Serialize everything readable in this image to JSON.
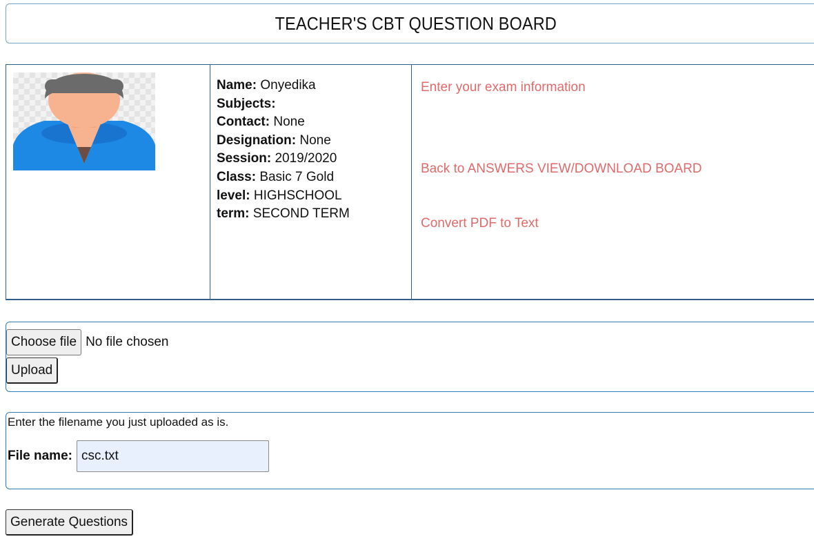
{
  "header": {
    "title": "TEACHER'S CBT QUESTION BOARD"
  },
  "profile": {
    "avatar_icon": "user-avatar-icon",
    "fields": [
      {
        "label": "Name:",
        "value": "Onyedika"
      },
      {
        "label": "Subjects:",
        "value": ""
      },
      {
        "label": "Contact:",
        "value": "None"
      },
      {
        "label": "Designation:",
        "value": "None"
      },
      {
        "label": "Session:",
        "value": "2019/2020"
      },
      {
        "label": "Class:",
        "value": "Basic 7 Gold"
      },
      {
        "label": "level:",
        "value": "HIGHSCHOOL"
      },
      {
        "label": "term:",
        "value": "SECOND TERM"
      }
    ],
    "links": {
      "exam_info": "Enter your exam information",
      "answers_board": "Back to ANSWERS VIEW/DOWNLOAD BOARD",
      "convert_pdf": "Convert PDF to Text"
    }
  },
  "upload": {
    "choose_label": "Choose file",
    "no_file_text": "No file chosen",
    "upload_label": "Upload"
  },
  "filename": {
    "hint": "Enter the filename you just uploaded as is.",
    "label": "File name:",
    "value": "csc.txt"
  },
  "generate": {
    "label": "Generate Questions"
  },
  "colors": {
    "link": "#e06a6a",
    "border": "#2e5f8c",
    "input_bg": "#e8f0fe",
    "avatar_shirt": "#1e88e5",
    "avatar_skin": "#f7b38f",
    "avatar_hair": "#6b6b6b"
  }
}
